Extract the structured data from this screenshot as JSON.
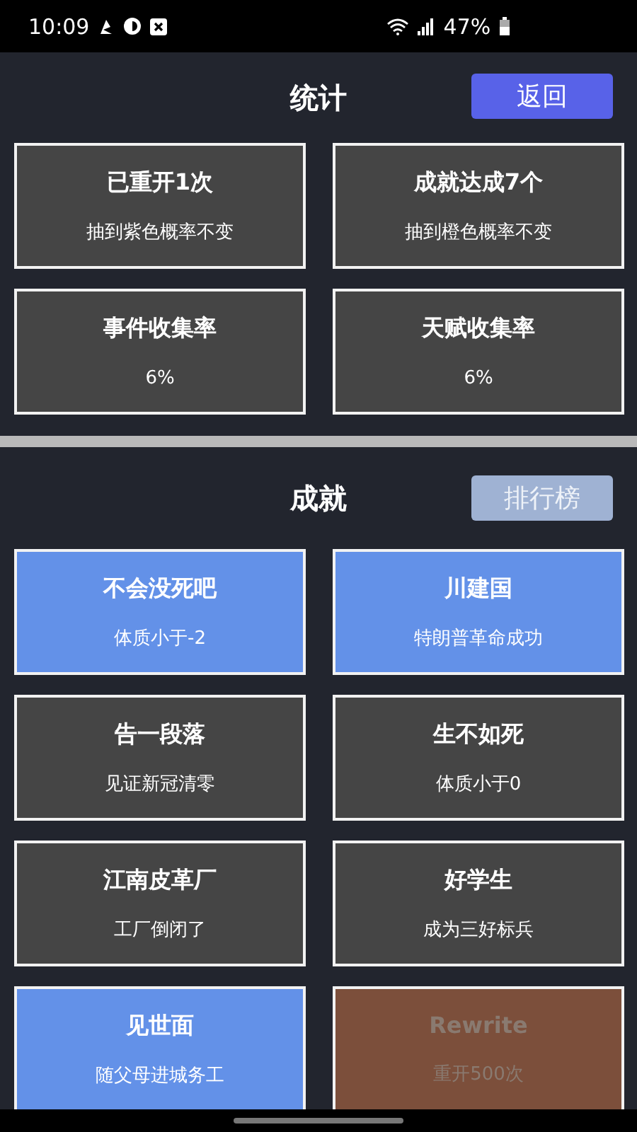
{
  "status_bar": {
    "time": "10:09",
    "battery": "47%"
  },
  "stats": {
    "title": "统计",
    "button": "返回",
    "cards": [
      {
        "title": "已重开1次",
        "subtitle": "抽到紫色概率不变"
      },
      {
        "title": "成就达成7个",
        "subtitle": "抽到橙色概率不变"
      },
      {
        "title": "事件收集率",
        "subtitle": "6%"
      },
      {
        "title": "天赋收集率",
        "subtitle": "6%"
      }
    ]
  },
  "achievements": {
    "title": "成就",
    "button": "排行榜",
    "button_disabled": true,
    "cards": [
      {
        "title": "不会没死吧",
        "subtitle": "体质小于-2",
        "color": "#6391e8",
        "dimmed": false
      },
      {
        "title": "川建国",
        "subtitle": "特朗普革命成功",
        "color": "#6391e8",
        "dimmed": false
      },
      {
        "title": "告一段落",
        "subtitle": "见证新冠清零",
        "color": "#454545",
        "dimmed": false
      },
      {
        "title": "生不如死",
        "subtitle": "体质小于0",
        "color": "#454545",
        "dimmed": false
      },
      {
        "title": "江南皮革厂",
        "subtitle": "工厂倒闭了",
        "color": "#454545",
        "dimmed": false
      },
      {
        "title": "好学生",
        "subtitle": "成为三好标兵",
        "color": "#454545",
        "dimmed": false
      },
      {
        "title": "见世面",
        "subtitle": "随父母进城务工",
        "color": "#6391e8",
        "dimmed": false
      },
      {
        "title": "Rewrite",
        "subtitle": "重开500次",
        "color": "#7c4f3b",
        "dimmed": true
      }
    ]
  }
}
